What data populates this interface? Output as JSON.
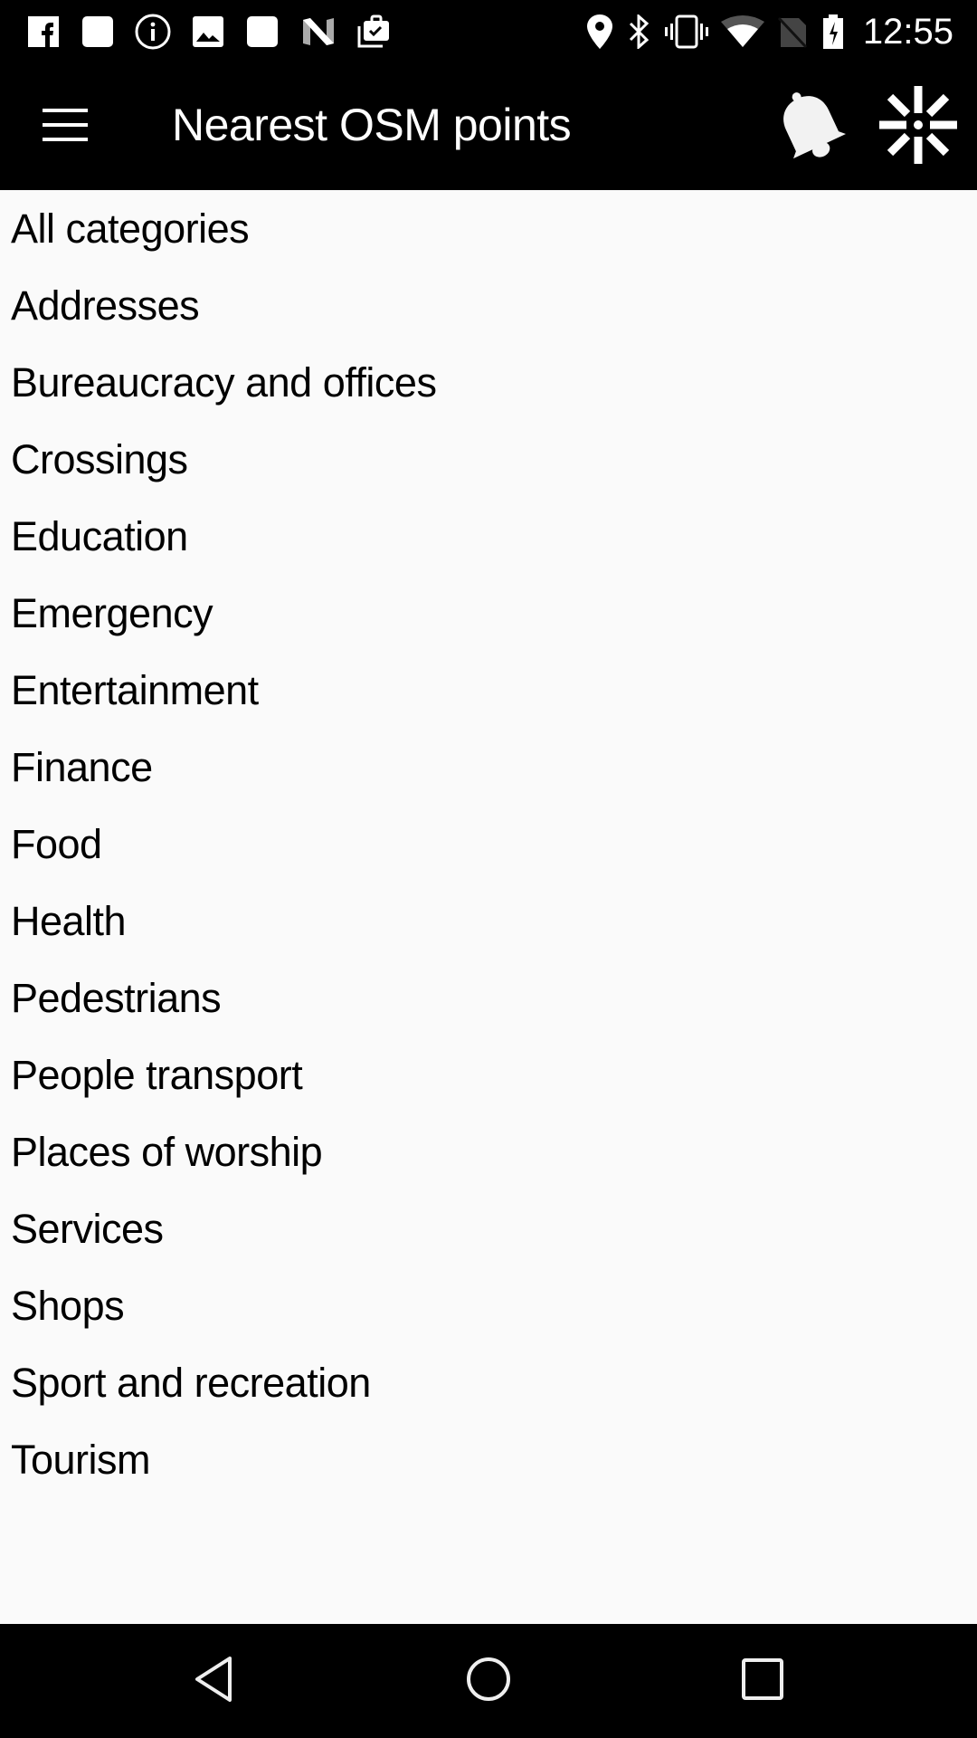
{
  "status_bar": {
    "time": "12:55",
    "left_icons": [
      "facebook-icon",
      "blank-notification-icon",
      "info-icon",
      "image-icon",
      "blank-notification-icon",
      "n-icon",
      "work-briefcase-check-icon"
    ],
    "right_icons": [
      "location-icon",
      "bluetooth-icon",
      "vibrate-icon",
      "wifi-icon",
      "no-sim-icon",
      "battery-charging-icon"
    ]
  },
  "app_bar": {
    "title": "Nearest OSM points",
    "menu_icon": "hamburger-menu-icon",
    "actions": [
      "bell-icon",
      "asterisk-settings-icon"
    ]
  },
  "categories": [
    {
      "label": "All categories"
    },
    {
      "label": "Addresses"
    },
    {
      "label": "Bureaucracy and offices"
    },
    {
      "label": "Crossings"
    },
    {
      "label": "Education"
    },
    {
      "label": "Emergency"
    },
    {
      "label": "Entertainment"
    },
    {
      "label": "Finance"
    },
    {
      "label": "Food"
    },
    {
      "label": "Health"
    },
    {
      "label": "Pedestrians"
    },
    {
      "label": "People transport"
    },
    {
      "label": "Places of worship"
    },
    {
      "label": "Services"
    },
    {
      "label": "Shops"
    },
    {
      "label": "Sport and recreation"
    },
    {
      "label": "Tourism"
    }
  ],
  "nav_bar": {
    "buttons": [
      "back-icon",
      "home-icon",
      "recents-icon"
    ]
  },
  "colors": {
    "bar_background": "#000000",
    "list_background": "#fafafa",
    "text": "#000000",
    "bar_text": "#ffffff"
  }
}
